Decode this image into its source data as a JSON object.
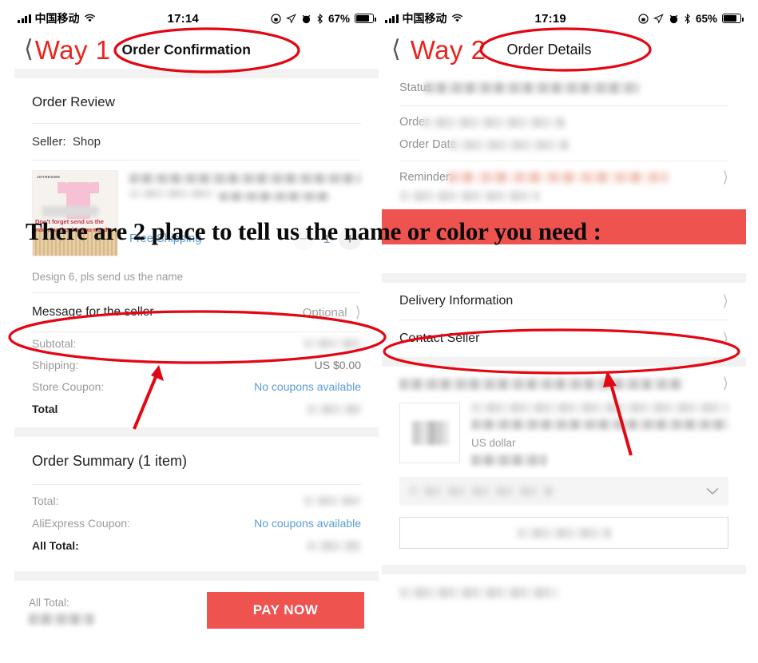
{
  "annotation": {
    "overlay_text": "There are 2 place to tell us the name or color you need :",
    "highlight_color": "#e30613",
    "arrow_color": "#e30613"
  },
  "left_panel": {
    "status_bar": {
      "carrier": "中国移动",
      "time": "17:14",
      "battery_percent": "67%",
      "icons": [
        "signal-bars-icon",
        "wifi-icon",
        "rotation-lock-icon",
        "location-arrow-icon",
        "alarm-clock-icon",
        "bluetooth-icon",
        "battery-icon"
      ]
    },
    "nav": {
      "back_icon": "chevron-left-icon",
      "way_label": "Way 1",
      "title": "Order Confirmation"
    },
    "order_review": {
      "section_title": "Order Review",
      "seller_label": "Seller:",
      "seller_name": "Shop",
      "product": {
        "thumb_brand": "JOYRESIDE",
        "thumb_caption": "Don't forget send us the name and color you need!",
        "shipping_label": "Free Shipping",
        "quantity": "1",
        "minus_icon": "minus-icon",
        "plus_icon": "plus-icon"
      },
      "design_note": "Design 6, pls send us the name",
      "message_row": {
        "label": "Message for the seller",
        "value": "Optional",
        "chevron": "chevron-right-icon"
      },
      "totals": [
        {
          "label": "Subtotal:",
          "value": "",
          "redacted": true,
          "link": false
        },
        {
          "label": "Shipping:",
          "value": "US $0.00",
          "redacted": false,
          "link": false
        },
        {
          "label": "Store Coupon:",
          "value": "No coupons available",
          "redacted": false,
          "link": true
        },
        {
          "label": "Total",
          "value": "",
          "redacted": true,
          "link": false,
          "bold": true
        }
      ]
    },
    "order_summary": {
      "section_title": "Order Summary (1 item)",
      "rows": [
        {
          "label": "Total:",
          "value": "",
          "redacted": true,
          "link": false
        },
        {
          "label": "AliExpress Coupon:",
          "value": "No coupons available",
          "redacted": false,
          "link": true
        },
        {
          "label": "All Total:",
          "value": "",
          "redacted": true,
          "link": false,
          "bold": true
        }
      ]
    },
    "pay_bar": {
      "all_total_label": "All Total:",
      "pay_button": "PAY NOW",
      "pay_button_color": "#ef5350"
    }
  },
  "right_panel": {
    "status_bar": {
      "carrier": "中国移动",
      "time": "17:19",
      "battery_percent": "65%",
      "icons": [
        "signal-bars-icon",
        "wifi-icon",
        "rotation-lock-icon",
        "location-arrow-icon",
        "alarm-clock-icon",
        "bluetooth-icon",
        "battery-icon"
      ]
    },
    "nav": {
      "back_icon": "chevron-left-icon",
      "way_label": "Way 2",
      "title": "Order Details"
    },
    "details": [
      {
        "label": "Status:",
        "redacted": true
      },
      {
        "label": "Order",
        "redacted": true
      },
      {
        "label": "Order Date",
        "redacted": true
      },
      {
        "label": "Reminder:",
        "redacted": true,
        "tone": "pink"
      }
    ],
    "links": [
      {
        "label": "Delivery Information",
        "chevron": "chevron-right-icon"
      },
      {
        "label": "Contact Seller",
        "chevron": "chevron-right-icon"
      }
    ],
    "product_card": {
      "currency_note": "US dollar",
      "select_chevron": "chevron-down-icon"
    }
  }
}
